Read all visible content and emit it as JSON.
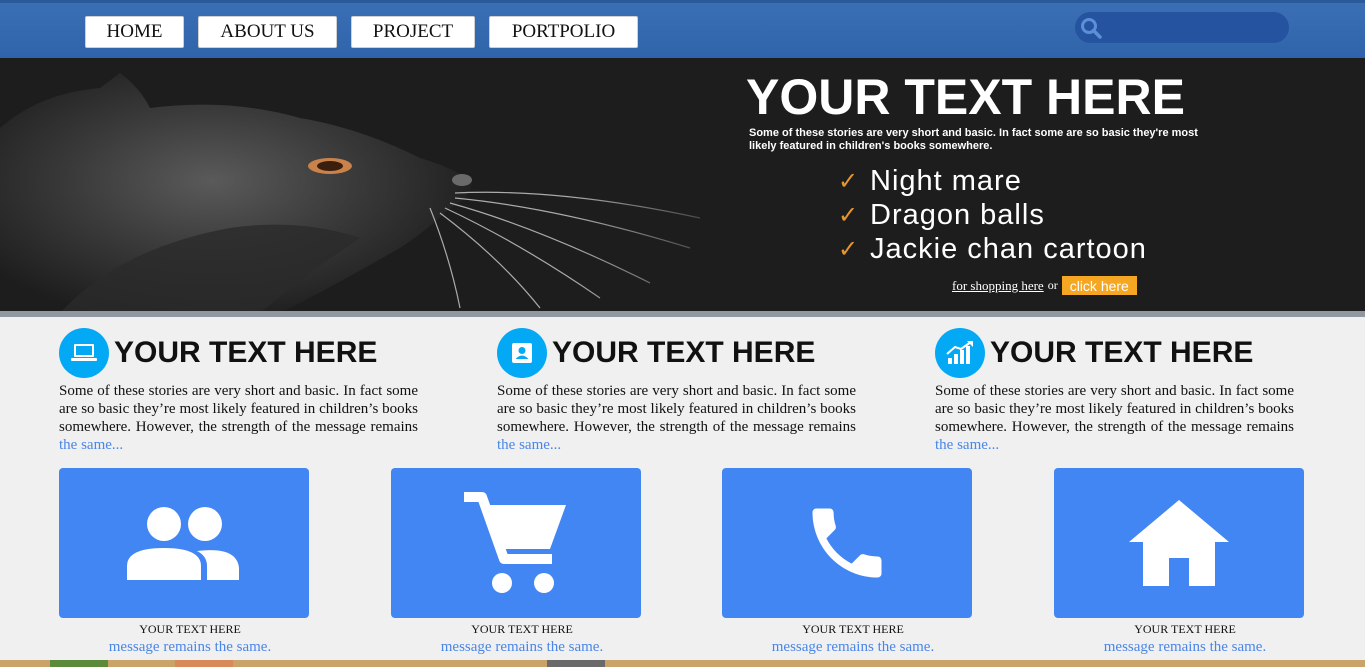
{
  "nav": {
    "items": [
      {
        "label": "HOME"
      },
      {
        "label": "ABOUT US"
      },
      {
        "label": "PROJECT"
      },
      {
        "label": "PORTPOLIO"
      }
    ],
    "search_placeholder": "",
    "search_icon": "search-icon"
  },
  "hero": {
    "title": "YOUR TEXT HERE",
    "description": "Some of these stories are very short and basic. In fact some are so basic they're most likely featured in children's books somewhere.",
    "list": [
      {
        "label": "Night mare"
      },
      {
        "label": "Dragon balls"
      },
      {
        "label": "Jackie chan cartoon"
      }
    ],
    "check_icon": "✓",
    "shop_link": "for shopping here ",
    "or_text": "or",
    "click_button": " click here",
    "check_color": "#e8962c",
    "button_color": "#f5a623"
  },
  "features": [
    {
      "icon": "laptop-icon",
      "title": "YOUR TEXT HERE",
      "text": "Some of these stories are very short and basic. In fact some are so basic they’re most likely featured in children’s books somewhere. However, the strength of the message remains ",
      "link": "the same..."
    },
    {
      "icon": "contact-icon",
      "title": "YOUR TEXT HERE",
      "text": "Some of these stories are very short and basic. In fact some are so basic they’re most likely featured in children’s books somewhere. However, the strength of the message remains ",
      "link": "the same..."
    },
    {
      "icon": "growth-chart-icon",
      "title": "YOUR TEXT HERE",
      "text": "Some of these stories are very short and basic. In fact some are so basic they’re most likely featured in children’s books somewhere. However, the strength of the message remains ",
      "link": "the same..."
    }
  ],
  "cards": [
    {
      "icon": "group-icon",
      "title": "YOUR TEXT HERE",
      "message": "message remains the same."
    },
    {
      "icon": "cart-icon",
      "title": "YOUR TEXT HERE",
      "message": "message remains the same."
    },
    {
      "icon": "phone-icon",
      "title": "YOUR TEXT HERE",
      "message": "message remains the same."
    },
    {
      "icon": "home-icon",
      "title": "YOUR TEXT HERE",
      "message": "message remains the same."
    }
  ],
  "colors": {
    "nav_bar": "#2f64ab",
    "feature_icon_bg": "#03a9f4",
    "card_bg": "#4286f4",
    "link": "#4a86e8"
  }
}
